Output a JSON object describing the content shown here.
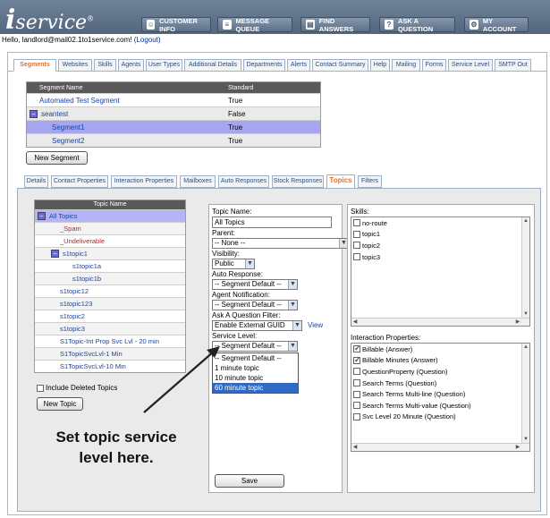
{
  "header": {
    "logo_i": "i",
    "logo_rest": "service",
    "logo_reg": "®",
    "nav": [
      {
        "label": "CUSTOMER INFO",
        "icon": "person-icon"
      },
      {
        "label": "MESSAGE QUEUE",
        "icon": "queue-icon"
      },
      {
        "label": "FIND ANSWERS",
        "icon": "book-icon"
      },
      {
        "label": "ASK A QUESTION",
        "icon": "question-icon"
      },
      {
        "label": "MY ACCOUNT",
        "icon": "gear-icon"
      }
    ]
  },
  "greeting": {
    "text": "Hello, landlord@mail02.1to1service.com!",
    "logout": "(Logout)"
  },
  "top_tabs": [
    "Segments",
    "Websites",
    "Skills",
    "Agents",
    "User Types",
    "Additional Details",
    "Departments",
    "Alerts",
    "Contact Summary",
    "Help",
    "Mailing",
    "Forms",
    "Service Level",
    "SMTP Out"
  ],
  "segment_table": {
    "headers": [
      "Segment Name",
      "Standard"
    ],
    "rows": [
      {
        "name": "Automated Test Segment",
        "standard": "True"
      },
      {
        "name": "seantest",
        "standard": "False"
      },
      {
        "name": "Segment1",
        "standard": "True"
      },
      {
        "name": "Segment2",
        "standard": "True"
      }
    ],
    "new_button": "New Segment"
  },
  "sub_tabs": [
    "Details",
    "Contact Properties",
    "Interaction Properties",
    "Mailboxes",
    "Auto Responses",
    "Stock Responses",
    "Topics",
    "Filters"
  ],
  "topic_tree": {
    "header": "Topic Name",
    "rows": [
      "All Topics",
      "_Spam",
      "_Undeliverable",
      "s1topic1",
      "s1topic1a",
      "s1topic1b",
      "s1topic12",
      "s1topic123",
      "s1topic2",
      "s1topic3",
      "S1Topic-Int Prop Svc Lvl - 20 min",
      "S1TopicSvcLvl-1 Min",
      "S1TopicSvcLvl-10 Min"
    ],
    "include_deleted": "Include Deleted Topics",
    "new_topic": "New Topic"
  },
  "form": {
    "topic_name_label": "Topic Name:",
    "topic_name_value": "All Topics",
    "parent_label": "Parent:",
    "parent_value": "-- None --",
    "visibility_label": "Visibility:",
    "visibility_value": "Public",
    "auto_response_label": "Auto Response:",
    "auto_response_value": "-- Segment Default --",
    "agent_notification_label": "Agent Notification:",
    "agent_notification_value": "-- Segment Default --",
    "ask_filter_label": "Ask A Question Filter:",
    "ask_filter_value": "Enable External GUID",
    "view_link": "View",
    "service_level_label": "Service Level:",
    "service_level_value": "-- Segment Default --",
    "service_level_options": [
      "-- Segment Default --",
      "1 minute topic",
      "10 minute topic",
      "60 minute topic"
    ],
    "save": "Save"
  },
  "skills": {
    "label": "Skills:",
    "items": [
      {
        "label": "no-route",
        "checked": false
      },
      {
        "label": "topic1",
        "checked": false
      },
      {
        "label": "topic2",
        "checked": false
      },
      {
        "label": "topic3",
        "checked": false
      }
    ]
  },
  "interaction_properties": {
    "label": "Interaction Properties:",
    "items": [
      {
        "label": "Billable (Answer)",
        "checked": true
      },
      {
        "label": "Billable Minutes (Answer)",
        "checked": true
      },
      {
        "label": "QuestionProperty (Question)",
        "checked": false
      },
      {
        "label": "Search Terms (Question)",
        "checked": false
      },
      {
        "label": "Search Terms Multi-line (Question)",
        "checked": false
      },
      {
        "label": "Search Terms Multi-value (Question)",
        "checked": false
      },
      {
        "label": "Svc Level 20 Minute (Question)",
        "checked": false
      }
    ]
  },
  "annotation": {
    "line1": "Set topic service",
    "line2": "level here."
  }
}
